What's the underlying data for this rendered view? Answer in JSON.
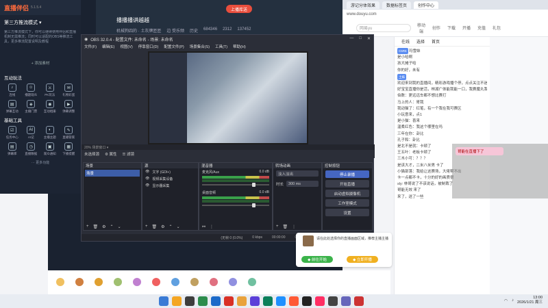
{
  "browser": {
    "tabs": [
      "游记分体效果",
      "数据标签页",
      "创作中心"
    ],
    "toolbar_text": "www.douyu.com",
    "search_placeholder": "网易yu",
    "nav_items": [
      "移动端",
      "创作",
      "下载",
      "开播",
      "充值",
      "礼包"
    ]
  },
  "stream": {
    "title": "播播播讲越越",
    "meta": [
      "机械狗四的 · 土灰牌匝匝",
      "边 受乐频",
      "历史",
      "684346",
      "2312",
      "137452"
    ],
    "live_button": "上播库送",
    "help_label": "弹幕助手"
  },
  "companion": {
    "logo": "直播伴侣",
    "version": "5.1.5.4",
    "mode": "第三方推流模式 ▾",
    "description": "第三方推流模式下，你可以继续使用伴侣和直播机制无需推流；同时可以适配的OBS等推流工具，更多推流配置说明及教程",
    "add_source": "+ 添加素材",
    "section_interact": "互动玩法",
    "interact_tools": [
      {
        "label": "连线",
        "icon": "♪"
      },
      {
        "label": "播题观众",
        "icon": "☺"
      },
      {
        "label": "PK玩法",
        "icon": "⚔"
      },
      {
        "label": "礼物彩蛋",
        "icon": "✉"
      },
      {
        "label": "弹幕互动",
        "icon": "▤"
      },
      {
        "label": "主播门票",
        "icon": "◈"
      },
      {
        "label": "互动相册",
        "icon": "◉"
      },
      {
        "label": "弹幕调整",
        "icon": "▶"
      }
    ],
    "section_basic": "基础工具",
    "basic_tools": [
      {
        "label": "任务中心",
        "icon": "☑"
      },
      {
        "label": "AI记",
        "icon": "AI"
      },
      {
        "label": "主播主题",
        "icon": "◐"
      },
      {
        "label": "直播管家",
        "icon": "✎"
      },
      {
        "label": "弹幕库",
        "icon": "▤"
      },
      {
        "label": "直播数据",
        "icon": "◷"
      },
      {
        "label": "观众通知",
        "icon": "▣"
      },
      {
        "label": "下播提醒",
        "icon": "▦"
      }
    ],
    "more": "··· 更多功能"
  },
  "obs": {
    "title": "OBS 32.0.4 - 配置文件: 未命名 - 场景: 未命名",
    "menu": [
      "文件(F)",
      "编辑(E)",
      "视图(V)",
      "停靠窗口(D)",
      "配置文件(P)",
      "场景集合(S)",
      "工具(T)",
      "帮助(H)"
    ],
    "scene_bar": "20%   场景窗口 ▾",
    "src_bar": [
      "未选择源",
      "⚙ 属性",
      "☰ 滤镜"
    ],
    "docks": {
      "scenes": {
        "title": "场景",
        "items": [
          "场景"
        ]
      },
      "sources": {
        "title": "源",
        "items": [
          "文字 (GDI+)",
          "视频采集设备",
          "显示器采集"
        ]
      },
      "mixer": {
        "title": "混音器",
        "channels": [
          {
            "name": "麦克风/Aux",
            "level": "0.0 dB"
          },
          {
            "name": "桌面音频",
            "level": "0.0 dB"
          }
        ]
      },
      "transitions": {
        "title": "转场动画",
        "type": "淡入淡出",
        "duration_label": "时长",
        "duration": "300 ms"
      },
      "controls": {
        "title": "控制按钮",
        "buttons": [
          "停止录播",
          "开始直播",
          "启动虚拟摄像机",
          "工作室模式",
          "设置"
        ]
      }
    },
    "status": [
      "(无帧 0 (0.0%)",
      "0 kbps",
      "00:00:00",
      "00:00:00",
      "CPU: 0.6%",
      "60.00 / 60.00 FPS"
    ]
  },
  "card": {
    "text": "请在此处选择你的直播画面区域，推荐主播主播",
    "btn_left": "◆ 前往开始",
    "btn_right": "◆ 立即开播"
  },
  "chat": {
    "tabs": [
      "在线",
      "选择",
      "首页"
    ],
    "messages": [
      {
        "user": "C5R5",
        "text": "玛雪妹"
      },
      {
        "user": "",
        "text": "是小哈啊"
      },
      {
        "user": "",
        "text": "孩大摊子哈"
      },
      {
        "user": "",
        "text": "你的好，未有"
      },
      {
        "user": "土妹",
        "text": ""
      },
      {
        "user": "",
        "text": "欢迎来到我的直播间，精彩游戏播个停，点点关注不迷路"
      },
      {
        "user": "",
        "text": "好宝宝直播你是活，林湖广体能我能一口，我赛魔丸我倒分"
      },
      {
        "user": "",
        "text": "伯数：更远远车都不想比赛打"
      },
      {
        "user": "",
        "text": "马上的人：哥我"
      },
      {
        "user": "",
        "text": "我动猫了：红笔，有一个我在我可赛区"
      },
      {
        "user": "",
        "text": "小玩意来，点1"
      },
      {
        "user": "",
        "text": "是小猫：喜来"
      },
      {
        "user": "",
        "text": "温柔红色：我这个哪里在吗"
      },
      {
        "user": "",
        "text": "三年在你：卦比"
      },
      {
        "user": "",
        "text": "孔子和：卦比"
      },
      {
        "user": "",
        "text": "是北不是就：卡顿了"
      },
      {
        "user": "",
        "text": "王五叶：老板卡顿了"
      },
      {
        "user": "",
        "text": "三木小可：？？？"
      },
      {
        "user": "",
        "text": "是该大才，二米八米男 卡了"
      },
      {
        "user": "",
        "text": "小猫部落：我给让这赛场，大佬帮不出"
      },
      {
        "user": "",
        "text": "卡一点都不卡，十分的好的画质很"
      },
      {
        "user": "",
        "text": "sly: 林哥说了不该说话，被制裁了"
      },
      {
        "user": "",
        "text": "哥能无效 来了"
      },
      {
        "user": "",
        "text": "来了，送了一些"
      }
    ],
    "overlay_msg": "哥能在直播下了"
  },
  "taskbar": {
    "time": "13:00",
    "date": "2026/1/21 周三"
  }
}
